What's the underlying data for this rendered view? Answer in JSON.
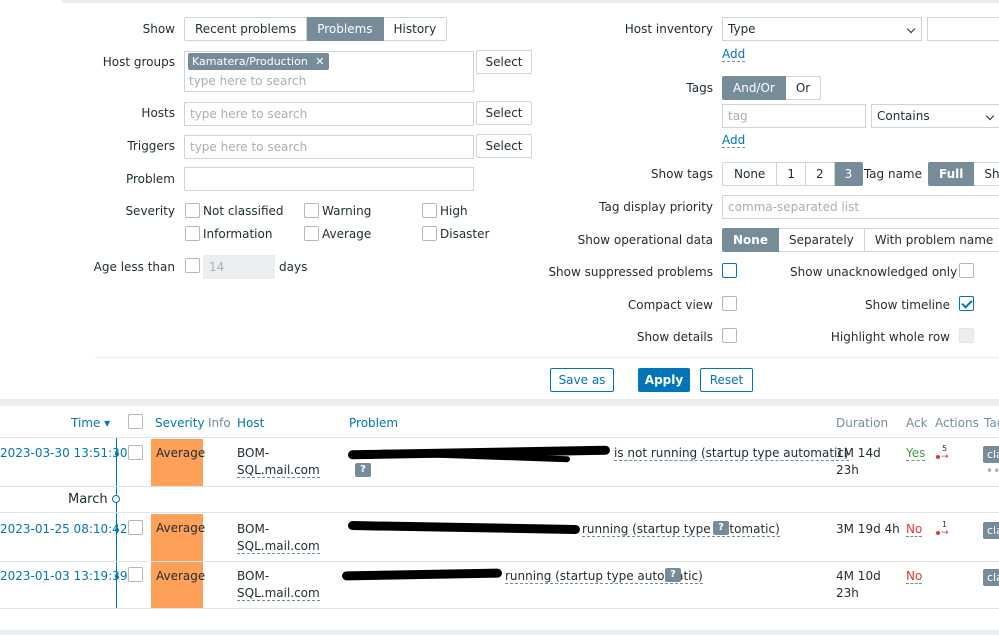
{
  "filter": {
    "show": {
      "label": "Show",
      "options": [
        "Recent problems",
        "Problems",
        "History"
      ],
      "active": "Problems"
    },
    "host_groups": {
      "label": "Host groups",
      "chip": "Kamatera/Production",
      "placeholder": "type here to search",
      "select": "Select"
    },
    "hosts": {
      "label": "Hosts",
      "placeholder": "type here to search",
      "select": "Select"
    },
    "triggers": {
      "label": "Triggers",
      "placeholder": "type here to search",
      "select": "Select"
    },
    "problem": {
      "label": "Problem",
      "value": ""
    },
    "severity": {
      "label": "Severity",
      "options": [
        "Not classified",
        "Warning",
        "High",
        "Information",
        "Average",
        "Disaster"
      ]
    },
    "age": {
      "label": "Age less than",
      "value": "14",
      "unit": "days"
    },
    "host_inventory": {
      "label": "Host inventory",
      "select_value": "Type",
      "value": "",
      "add": "Add"
    },
    "tags": {
      "label": "Tags",
      "options": [
        "And/Or",
        "Or"
      ],
      "active": "And/Or",
      "tag_placeholder": "tag",
      "operator": "Contains",
      "value": "",
      "add": "Add"
    },
    "show_tags": {
      "label": "Show tags",
      "options": [
        "None",
        "1",
        "2",
        "3"
      ],
      "active": "3"
    },
    "tag_name": {
      "label": "Tag name",
      "options": [
        "Full",
        "Sho"
      ],
      "active": "Full"
    },
    "tag_display_priority": {
      "label": "Tag display priority",
      "placeholder": "comma-separated list"
    },
    "show_operational_data": {
      "label": "Show operational data",
      "options": [
        "None",
        "Separately",
        "With problem name"
      ],
      "active": "None"
    },
    "show_suppressed": {
      "label": "Show suppressed problems",
      "checked": false
    },
    "show_unacknowledged": {
      "label": "Show unacknowledged only",
      "checked": false
    },
    "compact_view": {
      "label": "Compact view",
      "checked": false
    },
    "show_timeline": {
      "label": "Show timeline",
      "checked": true
    },
    "show_details": {
      "label": "Show details",
      "checked": false
    },
    "highlight_row": {
      "label": "Highlight whole row",
      "checked": false
    },
    "buttons": {
      "save_as": "Save as",
      "apply": "Apply",
      "reset": "Reset"
    }
  },
  "table": {
    "headers": {
      "time": "Time ▾",
      "severity": "Severity",
      "info": "Info",
      "host": "Host",
      "problem": "Problem",
      "duration": "Duration",
      "ack": "Ack",
      "actions": "Actions",
      "tags": "Tag"
    },
    "month_marker": "March",
    "rows": [
      {
        "time": "2023-03-30 13:51:30",
        "severity": "Average",
        "host_line1": "BOM-",
        "host_line2": "SQL.mail.com",
        "problem": "is not running (startup type automatic)",
        "duration_line1": "1M 14d",
        "duration_line2": "23h",
        "ack": "Yes",
        "actions_count": "5",
        "tag": "cla"
      },
      {
        "time": "2023-01-25 08:10:42",
        "severity": "Average",
        "host_line1": "BOM-",
        "host_line2": "SQL.mail.com",
        "problem": "running (startup type automatic)",
        "duration_line1": "3M 19d 4h",
        "duration_line2": "",
        "ack": "No",
        "actions_count": "1",
        "tag": "cla"
      },
      {
        "time": "2023-01-03 13:19:39",
        "severity": "Average",
        "host_line1": "BOM-",
        "host_line2": "SQL.mail.com",
        "problem": "running (startup type automatic)",
        "duration_line1": "4M 10d",
        "duration_line2": "23h",
        "ack": "No",
        "actions_count": "",
        "tag": "cla"
      }
    ]
  },
  "colors": {
    "accent": "#0275b8",
    "severity_average": "#ffa059",
    "ack_yes": "#429e47",
    "ack_no": "#e33734"
  }
}
